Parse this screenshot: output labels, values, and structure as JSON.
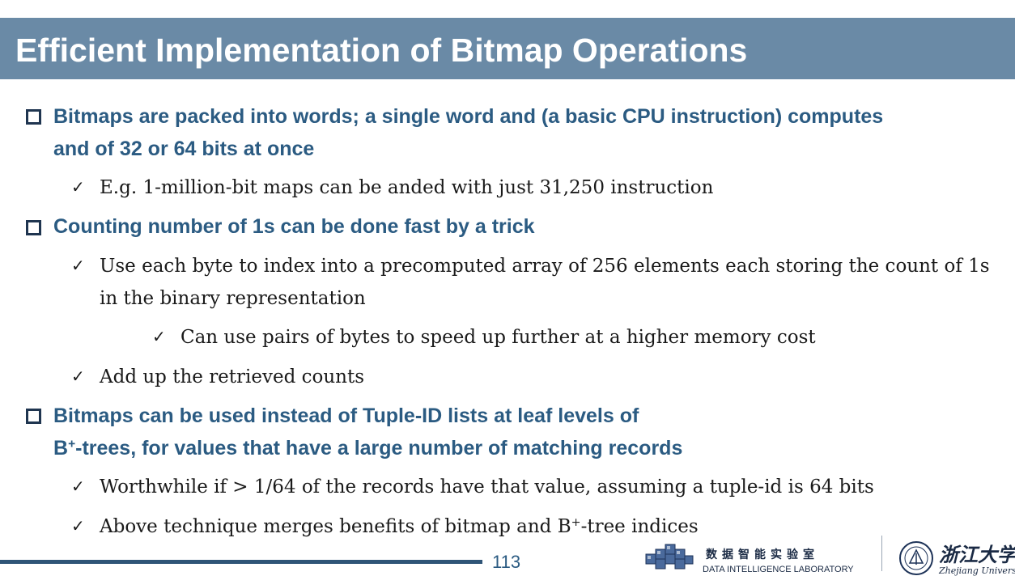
{
  "title": "Efficient Implementation of Bitmap Operations",
  "bullets": [
    {
      "line1": "Bitmaps are packed into words;  a single word and (a basic CPU instruction) computes",
      "line2": "and of 32 or 64 bits at once",
      "subs": [
        {
          "text": "E.g. 1-million-bit maps can be anded with just 31,250 instruction"
        }
      ]
    },
    {
      "line1": "Counting number of 1s can be done fast by a trick",
      "subs": [
        {
          "line1": "Use each byte to index into a precomputed array of 256 elements each storing the count of 1s",
          "line2": "in the binary representation"
        },
        {
          "text": "Can use pairs of bytes to speed up further at a higher memory cost"
        },
        {
          "text": "Add up the retrieved counts"
        }
      ]
    },
    {
      "line1": "Bitmaps can be used instead of Tuple-ID lists at leaf levels of",
      "line2_pre": "B",
      "line2_sup": "+",
      "line2_post": "-trees, for values that have a large number of matching records",
      "subs": [
        {
          "text": "Worthwhile if > 1/64 of the records have that value, assuming a tuple-id is 64 bits"
        },
        {
          "pre": "Above technique merges benefits of bitmap and B",
          "sup": "+",
          "post": "-tree indices"
        }
      ]
    }
  ],
  "check_glyph": "✓",
  "footer": {
    "page_number": "113",
    "lab_name_cn": "数据智能实验室",
    "lab_name_en": "DATA INTELLIGENCE LABORATORY",
    "university_cn": "浙江大学",
    "university_en": "Zhejiang University"
  },
  "colors": {
    "title_bar": "#6a8aa6",
    "heading_text": "#2b5b82",
    "body_text": "#1a1a1a",
    "footer_line": "#2f5577"
  }
}
